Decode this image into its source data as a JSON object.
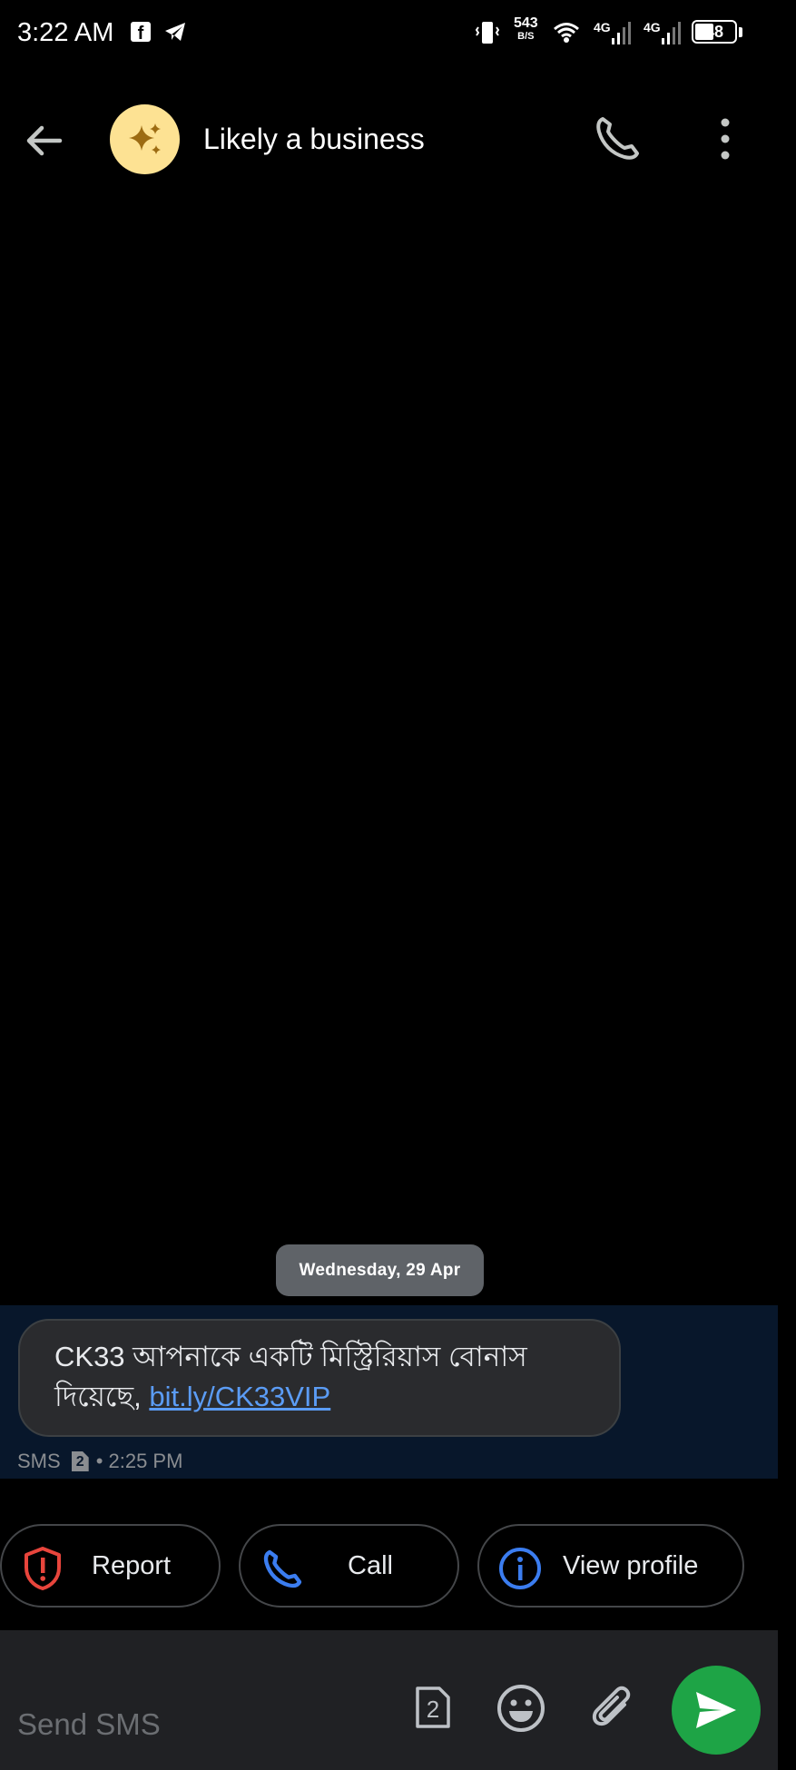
{
  "status_bar": {
    "time": "3:22 AM",
    "net_speed_value": "543",
    "net_speed_unit": "B/S",
    "sim1_network": "4G",
    "sim2_network": "4G",
    "battery": "48"
  },
  "app_bar": {
    "title": "Likely a business",
    "avatar_icon": "sparkle-icon"
  },
  "conversation": {
    "date_chip": "Wednesday, 29 Apr",
    "message": {
      "text": "CK33 আপনাকে একটি মিস্ট্রিরিয়াস বোনাস দিয়েছে,",
      "link": "bit.ly/CK33VIP",
      "channel": "SMS",
      "sim": "2",
      "time": "• 2:25 PM"
    }
  },
  "suggestions": [
    {
      "label": "Report",
      "icon": "report-icon",
      "color": "#e8453c"
    },
    {
      "label": "Call",
      "icon": "phone-icon",
      "color": "#3b7df0"
    },
    {
      "label": "View profile",
      "icon": "info-icon",
      "color": "#3b7df0"
    }
  ],
  "compose": {
    "placeholder": "Send SMS",
    "sim_label": "2"
  },
  "colors": {
    "background": "#000000",
    "message_band": "#08172b",
    "bubble": "#2a2b2e",
    "link": "#5b9cf5",
    "send_button": "#1ea446",
    "avatar_bg": "#fde293"
  }
}
